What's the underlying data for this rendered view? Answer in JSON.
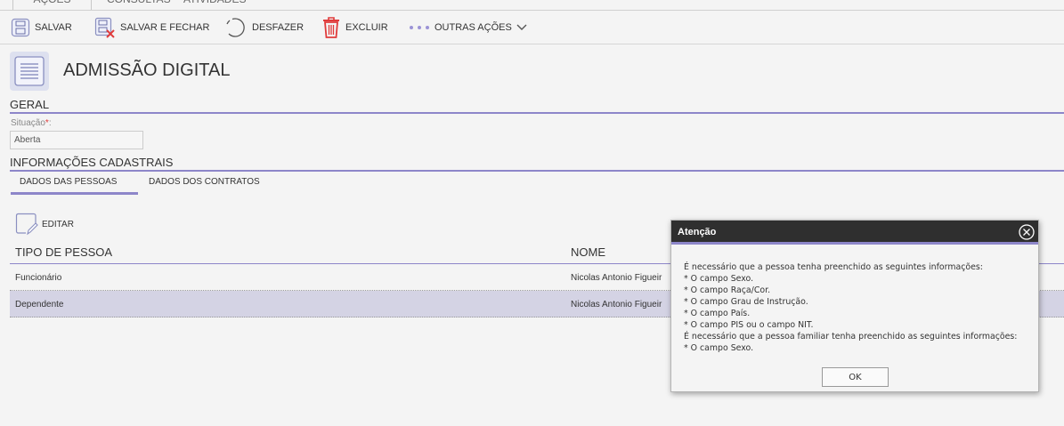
{
  "top_tabs": [
    "AÇÕES",
    "CONSULTAS",
    "ATIVIDADES"
  ],
  "toolbar": {
    "save_label": "SALVAR",
    "save_close_label": "SALVAR E FECHAR",
    "undo_label": "DESFAZER",
    "delete_label": "EXCLUIR",
    "more_label": "OUTRAS AÇÕES"
  },
  "page": {
    "title": "ADMISSÃO DIGITAL"
  },
  "geral": {
    "section_title": "GERAL",
    "situacao_label": "Situação",
    "situacao_required": "*",
    "situacao_colon": ":",
    "situacao_value": "Aberta"
  },
  "info": {
    "section_title": "INFORMAÇÕES CADASTRAIS",
    "tabs": [
      "DADOS DAS PESSOAS",
      "DADOS DOS CONTRATOS"
    ],
    "edit_label": "EDITAR",
    "columns": [
      "TIPO DE PESSOA",
      "NOME"
    ],
    "rows": [
      {
        "tipo": "Funcionário",
        "nome": "Nicolas Antonio Figueir"
      },
      {
        "tipo": "Dependente",
        "nome": "Nicolas Antonio Figueir"
      }
    ]
  },
  "dialog": {
    "title": "Atenção",
    "lines": [
      "É necessário que a pessoa tenha preenchido as seguintes informações:",
      "* O campo Sexo.",
      "* O campo Raça/Cor.",
      "* O campo Grau de Instrução.",
      "* O campo País.",
      "* O campo PIS ou o campo NIT.",
      "É necessário que a pessoa familiar tenha preenchido as seguintes informações:",
      "* O campo Sexo."
    ],
    "ok_label": "OK"
  }
}
